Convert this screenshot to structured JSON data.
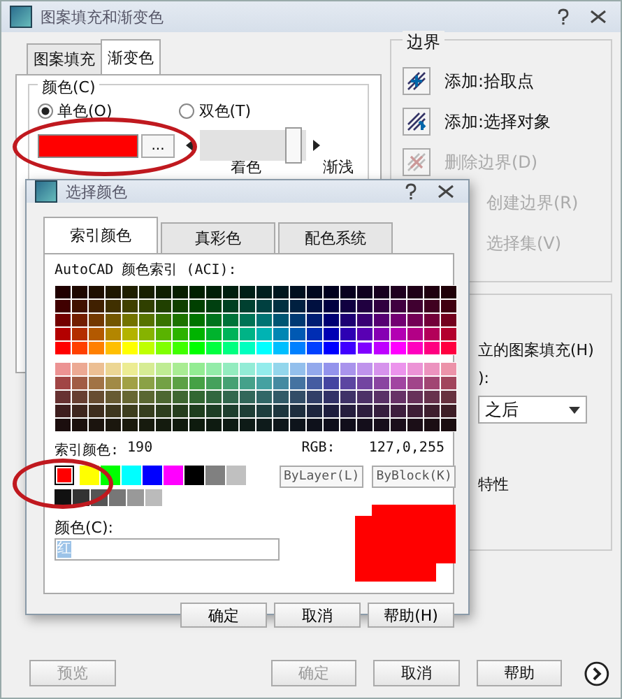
{
  "window": {
    "title": "图案填充和渐变色"
  },
  "tabs": [
    {
      "label": "图案填充",
      "selected": false
    },
    {
      "label": "渐变色",
      "selected": true
    }
  ],
  "color_group": {
    "title": "颜色(C)",
    "options": [
      {
        "label": "单色(O)",
        "selected": true
      },
      {
        "label": "双色(T)",
        "selected": false
      }
    ],
    "swatch": {
      "color": "#ff0000",
      "circled": true
    },
    "browse_button": "...",
    "shade": {
      "level": 0.93
    },
    "shade_labels": [
      "着色",
      "渐浅"
    ]
  },
  "boundaries": {
    "title": "边界",
    "items": [
      {
        "label": "添加:拾取点",
        "disabled": false,
        "covered": false
      },
      {
        "label": "添加:选择对象",
        "disabled": false,
        "covered": false
      },
      {
        "label": "删除边界(D)",
        "disabled": true,
        "covered": false
      },
      {
        "label": "创建边界(R)",
        "disabled": true,
        "covered": true
      },
      {
        "label": "选择集(V)",
        "disabled": true,
        "covered": true
      }
    ]
  },
  "options_group": {
    "texts": [
      "立的图案填充(H)",
      "):"
    ],
    "draw_order": "之后",
    "properties": "特性"
  },
  "buttons": [
    {
      "label": "预览",
      "disabled": true
    },
    {
      "label": "确定",
      "disabled": true
    },
    {
      "label": "取消",
      "disabled": false
    },
    {
      "label": "帮助",
      "disabled": false
    }
  ],
  "color_dialog": {
    "title": "选择颜色",
    "tabs": [
      {
        "label": "索引颜色",
        "selected": true
      },
      {
        "label": "真彩色",
        "selected": false
      },
      {
        "label": "配色系统",
        "selected": false
      }
    ],
    "palette_label": "AutoCAD 颜色索引 (ACI):",
    "index_label": "索引颜色:",
    "index_value": "190",
    "rgb_label": "RGB:",
    "rgb_value": "127,0,255",
    "standard_colors": [
      {
        "color": "#ff0000",
        "selected": true
      },
      {
        "color": "#ffff00",
        "selected": false
      },
      {
        "color": "#00ff00",
        "selected": false
      },
      {
        "color": "#00ffff",
        "selected": false
      },
      {
        "color": "#0000ff",
        "selected": false
      },
      {
        "color": "#ff00ff",
        "selected": false
      },
      {
        "color": "#000000",
        "selected": false
      },
      {
        "color": "#808080",
        "selected": false
      },
      {
        "color": "#c0c0c0",
        "selected": false
      }
    ],
    "gray_colors": [
      {
        "color": "#111111"
      },
      {
        "color": "#333333"
      },
      {
        "color": "#555555"
      },
      {
        "color": "#777777"
      },
      {
        "color": "#999999"
      },
      {
        "color": "#bbbbbb"
      }
    ],
    "by_buttons": [
      "ByLayer(L)",
      "ByBlock(K)"
    ],
    "color_field_label": "颜色(C):",
    "color_field_value": "红",
    "preview": {
      "color": "#ff0000"
    },
    "buttons": [
      "确定",
      "取消",
      "帮助(H)"
    ]
  }
}
